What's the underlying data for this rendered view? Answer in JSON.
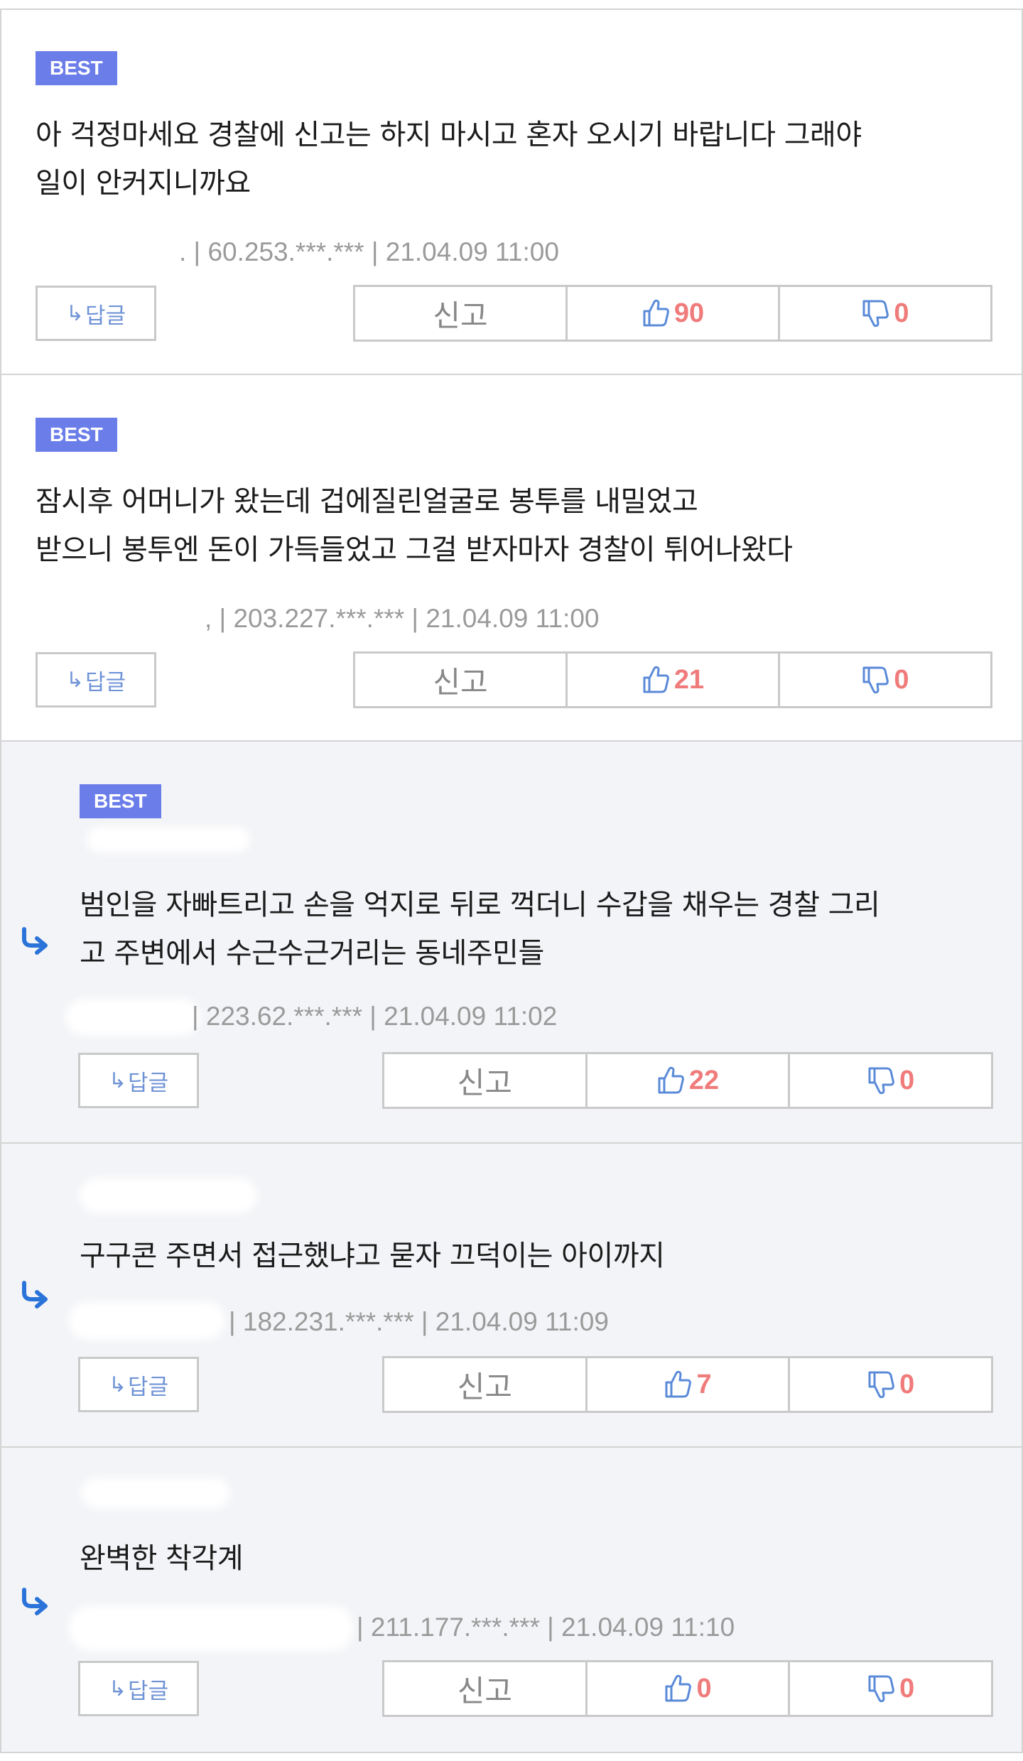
{
  "labels": {
    "best": "BEST",
    "reply_button": "답글",
    "report": "신고"
  },
  "icons": {
    "reply_arrow": "↳",
    "like": "thumbs-up-icon",
    "dislike": "thumbs-down-icon",
    "reply_marker": "reply-arrow-icon"
  },
  "colors": {
    "best_badge": "#6b7de9",
    "count": "#f07b7b",
    "reply_marker": "#2a73d9",
    "reply_bg": "#f3f4f7"
  },
  "comments": [
    {
      "text": "아 걱정마세요 경찰에 신고는 하지 마시고 혼자 오시기 바랍니다 그래야\n일이 안커지니까요",
      "meta": ". | 60.253.***.*** | 21.04.09 11:00",
      "likes": "90",
      "dislikes": "0"
    },
    {
      "text": "잠시후 어머니가 왔는데 겁에질린얼굴로 봉투를 내밀었고\n받으니 봉투엔 돈이 가득들었고 그걸 받자마자 경찰이 튀어나왔다",
      "meta": ", | 203.227.***.*** | 21.04.09 11:00",
      "likes": "21",
      "dislikes": "0"
    },
    {
      "text": "범인을 자빠트리고 손을 억지로 뒤로 꺽더니 수갑을 채우는 경찰 그리\n고 주변에서 수근수근거리는 동네주민들",
      "meta": "| 223.62.***.*** | 21.04.09 11:02",
      "likes": "22",
      "dislikes": "0"
    },
    {
      "text": "구구콘 주면서 접근했냐고 묻자 끄덕이는 아이까지",
      "meta": "| 182.231.***.*** | 21.04.09 11:09",
      "likes": "7",
      "dislikes": "0"
    },
    {
      "text": "완벽한 착각계",
      "meta": "| 211.177.***.*** | 21.04.09 11:10",
      "likes": "0",
      "dislikes": "0"
    }
  ]
}
